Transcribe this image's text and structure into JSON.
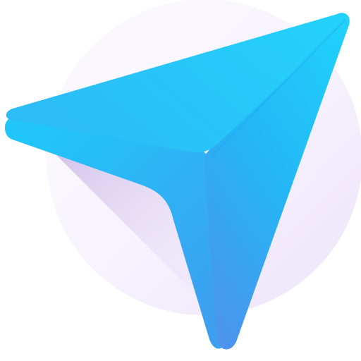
{
  "icon": {
    "name": "navigation-arrow-icon",
    "colors": {
      "background": "#ffffff",
      "circle_light": "#fbf8ff",
      "circle_dark": "#ede3fb",
      "arrow_top": "#1dd2fb",
      "arrow_mid": "#25b8f7",
      "arrow_bottom": "#4aa0f2",
      "shadow": "#cdbde8"
    }
  }
}
